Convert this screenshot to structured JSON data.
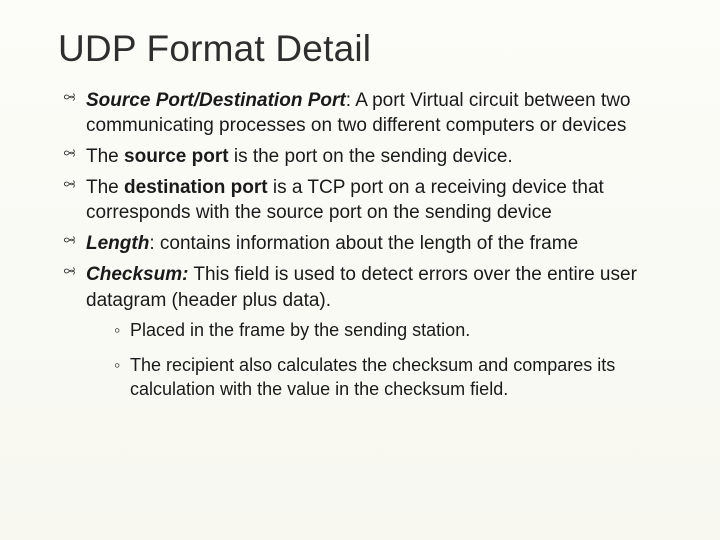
{
  "title": "UDP Format Detail",
  "bullets": [
    {
      "lead_bi": "Source Port/Destination Port",
      "rest": ": A port  Virtual circuit between two communicating processes on two different computers or devices"
    },
    {
      "pre": "The ",
      "b": "source port",
      "rest": " is the port on the sending device."
    },
    {
      "pre": "The ",
      "b": "destination port",
      "rest": " is a TCP port on a receiving device that corresponds with the source port on the sending device"
    },
    {
      "bi": "Length",
      "rest": ": contains information about the length of the frame"
    },
    {
      "bi": "Checksum:",
      "rest": " This field is used to detect errors over the entire user datagram (header plus data)."
    }
  ],
  "sub": [
    "Placed in the frame by the sending station.",
    "The recipient also calculates the checksum and compares its calculation with the value in the checksum field."
  ]
}
